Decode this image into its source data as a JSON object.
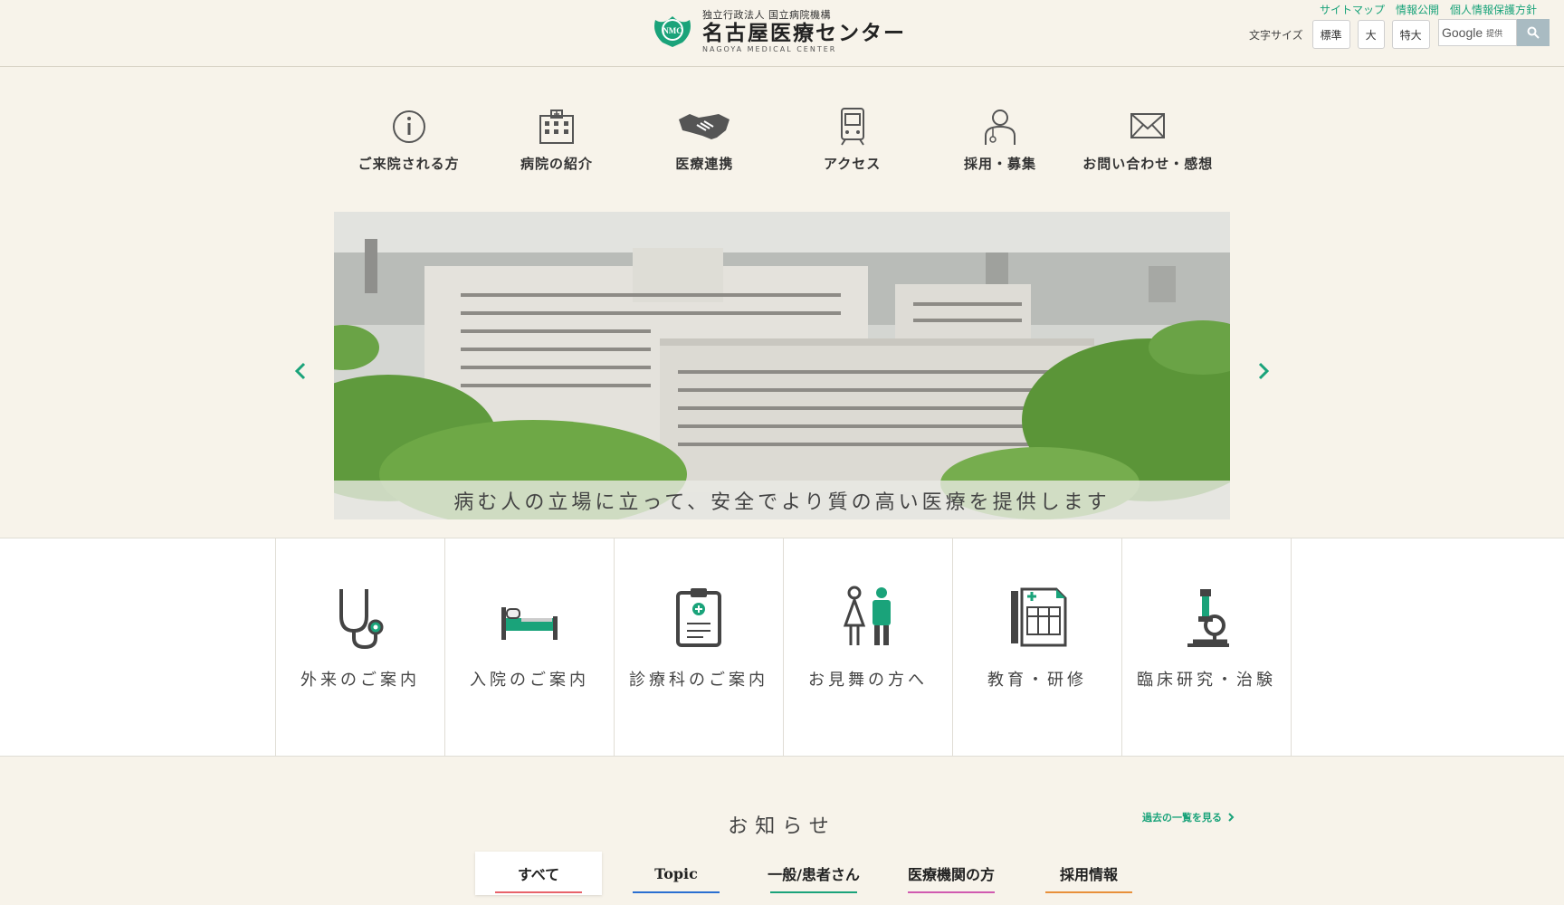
{
  "header": {
    "org_sub": "独立行政法人 国立病院機構",
    "org_name": "名古屋医療センター",
    "org_en": "NAGOYA MEDICAL CENTER",
    "emblem_text": "NMC",
    "util_links": [
      "サイトマップ",
      "情報公開",
      "個人情報保護方針"
    ],
    "font_size_label": "文字サイズ",
    "font_sizes": [
      "標準",
      "大",
      "特大"
    ],
    "search_brand": "Google",
    "search_provided": "提供"
  },
  "gnav": [
    {
      "icon": "info-icon",
      "label": "ご来院される方"
    },
    {
      "icon": "hospital-icon",
      "label": "病院の紹介"
    },
    {
      "icon": "handshake-icon",
      "label": "医療連携"
    },
    {
      "icon": "train-icon",
      "label": "アクセス"
    },
    {
      "icon": "person-icon",
      "label": "採用・募集"
    },
    {
      "icon": "mail-icon",
      "label": "お問い合わせ・感想"
    }
  ],
  "hero": {
    "caption": "病む人の立場に立って、安全でより質の高い医療を提供します"
  },
  "categories": [
    {
      "icon": "stethoscope-icon",
      "label": "外来のご案内"
    },
    {
      "icon": "bed-icon",
      "label": "入院のご案内"
    },
    {
      "icon": "clipboard-icon",
      "label": "診療科のご案内"
    },
    {
      "icon": "visitors-icon",
      "label": "お見舞の方へ"
    },
    {
      "icon": "textbook-icon",
      "label": "教育・研修"
    },
    {
      "icon": "microscope-icon",
      "label": "臨床研究・治験"
    }
  ],
  "news": {
    "title": "お知らせ",
    "archive_link": "過去の一覧を見る",
    "tabs": [
      {
        "label": "すべて",
        "color": "#e8636b",
        "active": true
      },
      {
        "label": "Topic",
        "color": "#2a6fd1",
        "active": false
      },
      {
        "label": "一般/患者さん",
        "color": "#1aa37a",
        "active": false
      },
      {
        "label": "医療機関の方",
        "color": "#d05ab0",
        "active": false
      },
      {
        "label": "採用情報",
        "color": "#e8903a",
        "active": false
      }
    ]
  },
  "colors": {
    "accent": "#1aa37a",
    "background": "#f7f3ea"
  }
}
